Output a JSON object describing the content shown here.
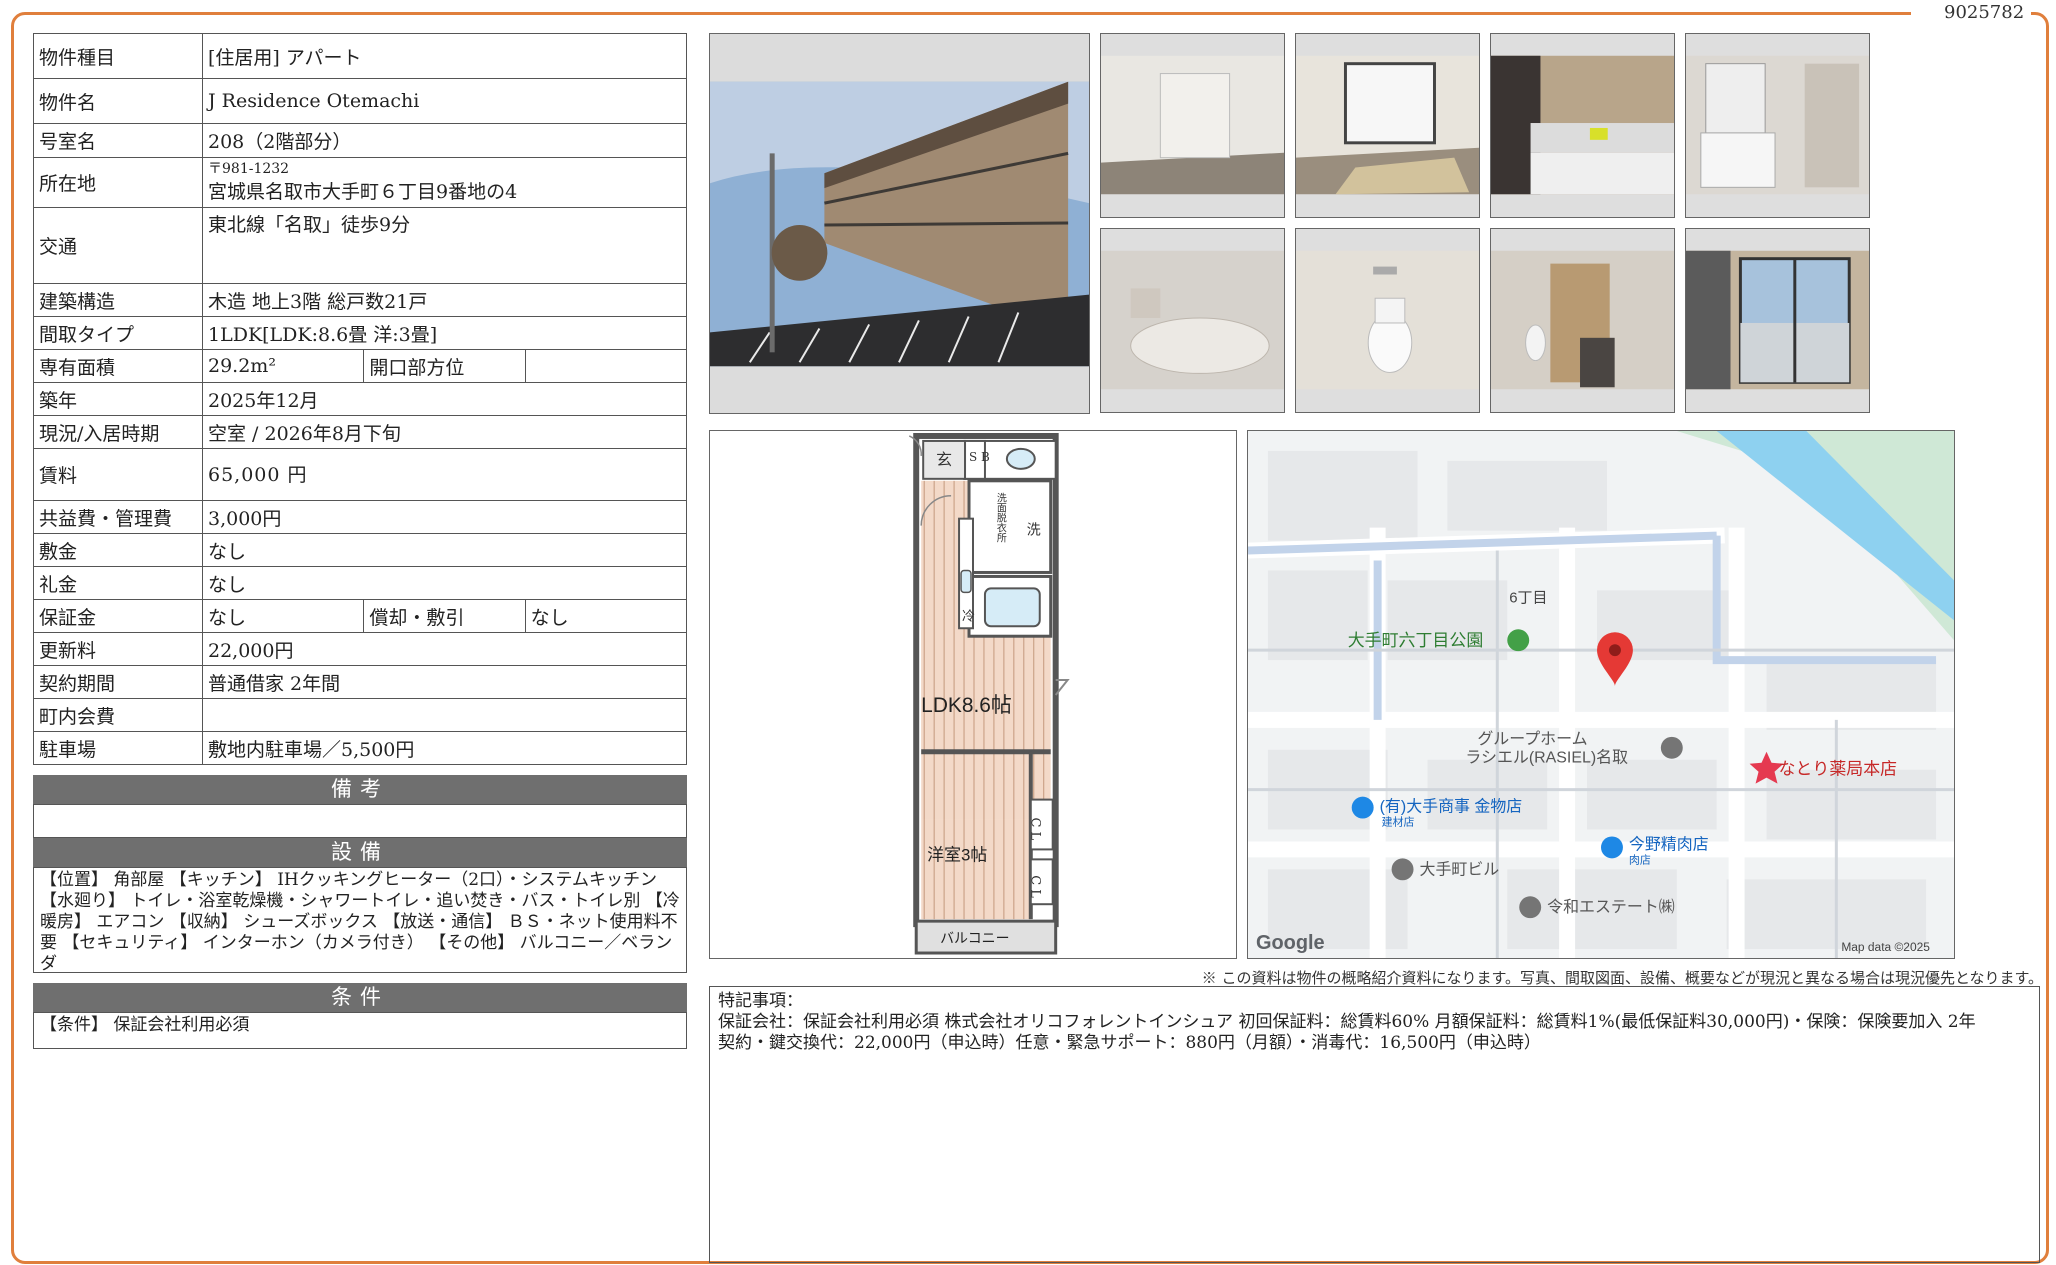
{
  "doc_code": "9025782",
  "property": {
    "type_label": "物件種目",
    "type_value": "[住居用] アパート",
    "name_label": "物件名",
    "name_value": "J Residence Otemachi",
    "room_label": "号室名",
    "room_value": "208（2階部分）",
    "address_label": "所在地",
    "zip": "〒981-1232",
    "address_value": "宮城県名取市大手町６丁目9番地の4",
    "access_label": "交通",
    "access_value": "東北線「名取」徒歩9分",
    "structure_label": "建築構造",
    "structure_value": "木造 地上3階 総戸数21戸",
    "layout_label": "間取タイプ",
    "layout_value": "1LDK[LDK:8.6畳 洋:3畳]",
    "area_label": "専有面積",
    "area_value": "29.2m²",
    "direction_label": "開口部方位",
    "direction_value": "",
    "built_label": "築年",
    "built_value": "2025年12月",
    "status_label": "現況/入居時期",
    "status_value": "空室 / 2026年8月下旬",
    "rent_label": "賃料",
    "rent_value": "65,000 円",
    "fee_label": "共益費・管理費",
    "fee_value": "3,000円",
    "deposit_label": "敷金",
    "deposit_value": "なし",
    "key_money_label": "礼金",
    "key_money_value": "なし",
    "guarantee_label": "保証金",
    "guarantee_value": "なし",
    "amort_label": "償却・敷引",
    "amort_value": "なし",
    "renewal_label": "更新料",
    "renewal_value": "22,000円",
    "contract_label": "契約期間",
    "contract_value": "普通借家 2年間",
    "town_label": "町内会費",
    "town_value": "",
    "parking_label": "駐車場",
    "parking_value": "敷地内駐車場／5,500円"
  },
  "sections": {
    "remarks_title": "備考",
    "remarks_text": "",
    "equipment_title": "設備",
    "equipment_text": "【位置】 角部屋 【キッチン】 IHクッキングヒーター（2口）・システムキッチン 【水廻り】 トイレ・浴室乾燥機・シャワートイレ・追い焚き・バス・トイレ別 【冷暖房】 エアコン 【収納】 シューズボックス 【放送・通信】 ＢＳ・ネット使用料不要 【セキュリティ】 インターホン（カメラ付き） 【その他】 バルコニー／ベランダ",
    "conditions_title": "条件",
    "conditions_text": "【条件】 保証会社利用必須"
  },
  "floorplan": {
    "genkan": "玄",
    "sb": "S B",
    "washroom": "洗面脱衣所",
    "wash": "洗",
    "fridge": "冷",
    "ldk": "LDK8.6帖",
    "western": "洋室3帖",
    "cl1": "C L",
    "cl2": "C L",
    "balcony": "バルコニー"
  },
  "map": {
    "chome": "6丁目",
    "park": "大手町六丁目公園",
    "group_home1": "グループホーム",
    "group_home2": "ラシエル(RASIEL)名取",
    "pharmacy": "なとり薬局本店",
    "shoji": "(有)大手商事 金物店",
    "shoji_sub": "建材店",
    "meat": "今野精肉店",
    "meat_sub": "肉店",
    "building": "大手町ビル",
    "estate": "令和エステート㈱",
    "google": "Google",
    "copyright": "Map data ©2025"
  },
  "disclaimer": "※ この資料は物件の概略紹介資料になります。写真、間取図面、設備、概要などが現況と異なる場合は現況優先となります。",
  "special": {
    "title": "特記事項：",
    "line1": "保証会社：保証会社利用必須 株式会社オリコフォレントインシュア 初回保証料：総賃料60% 月額保証料：総賃料1%(最低保証料30,000円)・保険：保険要加入 2年",
    "line2": "契約・鍵交換代：22,000円（申込時）任意・緊急サポート：880円（月額）・消毒代：16,500円（申込時）"
  }
}
